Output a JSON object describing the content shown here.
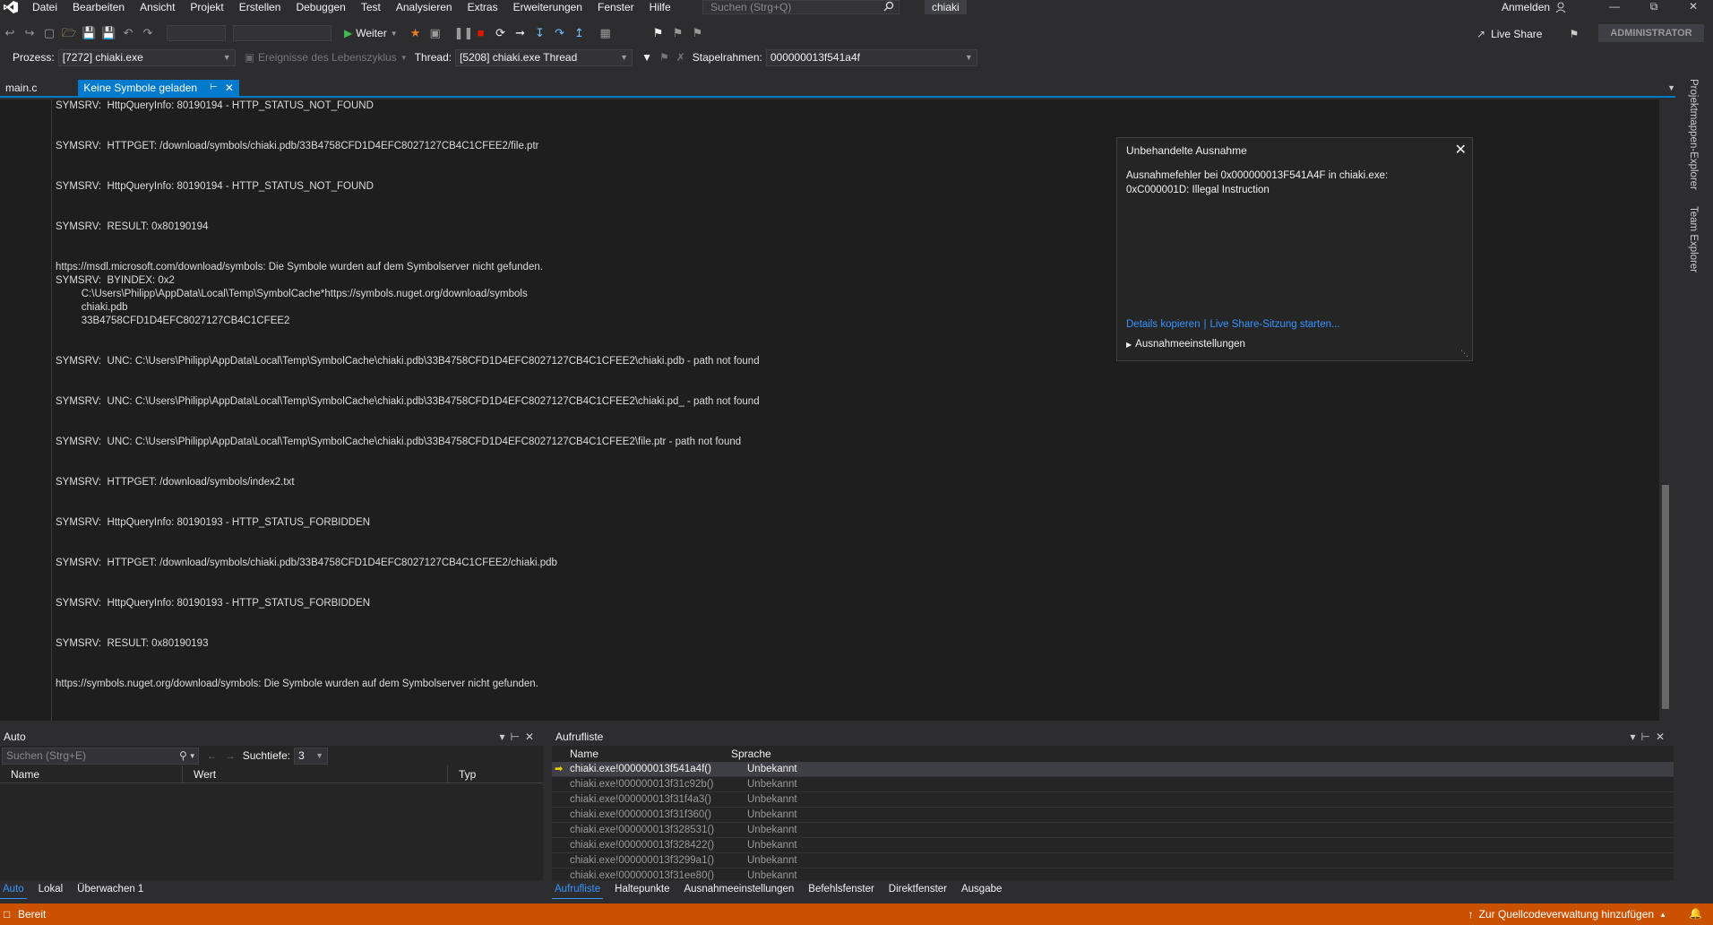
{
  "menubar": {
    "items": [
      "Datei",
      "Bearbeiten",
      "Ansicht",
      "Projekt",
      "Erstellen",
      "Debuggen",
      "Test",
      "Analysieren",
      "Extras",
      "Erweiterungen",
      "Fenster",
      "Hilfe"
    ],
    "search_placeholder": "Suchen (Strg+Q)",
    "solution": "chiaki",
    "signin": "Anmelden"
  },
  "toolbar": {
    "continue_label": "Weiter",
    "liveshare_label": "Live Share",
    "admin_label": "ADMINISTRATOR"
  },
  "debug_location": {
    "process_label": "Prozess:",
    "process_value": "[7272] chiaki.exe",
    "lifecycle_label": "Ereignisse des Lebenszyklus",
    "thread_label": "Thread:",
    "thread_value": "[5208] chiaki.exe Thread",
    "frame_label": "Stapelrahmen:",
    "frame_value": "000000013f541a4f"
  },
  "doc_tabs": {
    "file_tab": "main.c",
    "active_tab": "Keine Symbole geladen"
  },
  "log_lines": [
    "SYMSRV:  HttpQueryInfo: 80190194 - HTTP_STATUS_NOT_FOUND",
    "",
    "",
    "SYMSRV:  HTTPGET: /download/symbols/chiaki.pdb/33B4758CFD1D4EFC8027127CB4C1CFEE2/file.ptr",
    "",
    "",
    "SYMSRV:  HttpQueryInfo: 80190194 - HTTP_STATUS_NOT_FOUND",
    "",
    "",
    "SYMSRV:  RESULT: 0x80190194",
    "",
    "",
    "https://msdl.microsoft.com/download/symbols: Die Symbole wurden auf dem Symbolserver nicht gefunden.",
    "SYMSRV:  BYINDEX: 0x2",
    "         C:\\Users\\Philipp\\AppData\\Local\\Temp\\SymbolCache*https://symbols.nuget.org/download/symbols",
    "         chiaki.pdb",
    "         33B4758CFD1D4EFC8027127CB4C1CFEE2",
    "",
    "",
    "SYMSRV:  UNC: C:\\Users\\Philipp\\AppData\\Local\\Temp\\SymbolCache\\chiaki.pdb\\33B4758CFD1D4EFC8027127CB4C1CFEE2\\chiaki.pdb - path not found",
    "",
    "",
    "SYMSRV:  UNC: C:\\Users\\Philipp\\AppData\\Local\\Temp\\SymbolCache\\chiaki.pdb\\33B4758CFD1D4EFC8027127CB4C1CFEE2\\chiaki.pd_ - path not found",
    "",
    "",
    "SYMSRV:  UNC: C:\\Users\\Philipp\\AppData\\Local\\Temp\\SymbolCache\\chiaki.pdb\\33B4758CFD1D4EFC8027127CB4C1CFEE2\\file.ptr - path not found",
    "",
    "",
    "SYMSRV:  HTTPGET: /download/symbols/index2.txt",
    "",
    "",
    "SYMSRV:  HttpQueryInfo: 80190193 - HTTP_STATUS_FORBIDDEN",
    "",
    "",
    "SYMSRV:  HTTPGET: /download/symbols/chiaki.pdb/33B4758CFD1D4EFC8027127CB4C1CFEE2/chiaki.pdb",
    "",
    "",
    "SYMSRV:  HttpQueryInfo: 80190193 - HTTP_STATUS_FORBIDDEN",
    "",
    "",
    "SYMSRV:  RESULT: 0x80190193",
    "",
    "",
    "https://symbols.nuget.org/download/symbols: Die Symbole wurden auf dem Symbolserver nicht gefunden."
  ],
  "exception": {
    "title": "Unbehandelte Ausnahme",
    "message_line1": "Ausnahmefehler bei 0x000000013F541A4F in chiaki.exe:",
    "message_line2": "0xC000001D: Illegal Instruction",
    "link_copy": "Details kopieren",
    "link_liveshare": "Live Share-Sitzung starten...",
    "settings": "Ausnahmeeinstellungen"
  },
  "side_tabs": [
    "Projektmappen-Explorer",
    "Team Explorer"
  ],
  "auto_panel": {
    "title": "Auto",
    "search_placeholder": "Suchen (Strg+E)",
    "depth_label": "Suchtiefe:",
    "depth_value": "3",
    "columns": [
      "Name",
      "Wert",
      "Typ"
    ],
    "tabs": [
      "Auto",
      "Lokal",
      "Überwachen 1"
    ]
  },
  "call_panel": {
    "title": "Aufrufliste",
    "columns": [
      "Name",
      "Sprache"
    ],
    "rows": [
      {
        "name": "chiaki.exe!000000013f541a4f()",
        "lang": "Unbekannt"
      },
      {
        "name": "chiaki.exe!000000013f31c92b()",
        "lang": "Unbekannt"
      },
      {
        "name": "chiaki.exe!000000013f31f4a3()",
        "lang": "Unbekannt"
      },
      {
        "name": "chiaki.exe!000000013f31f360()",
        "lang": "Unbekannt"
      },
      {
        "name": "chiaki.exe!000000013f328531()",
        "lang": "Unbekannt"
      },
      {
        "name": "chiaki.exe!000000013f328422()",
        "lang": "Unbekannt"
      },
      {
        "name": "chiaki.exe!000000013f3299a1()",
        "lang": "Unbekannt"
      },
      {
        "name": "chiaki.exe!000000013f31ee80()",
        "lang": "Unbekannt"
      }
    ],
    "tabs": [
      "Aufrufliste",
      "Haltepunkte",
      "Ausnahmeeinstellungen",
      "Befehlsfenster",
      "Direktfenster",
      "Ausgabe"
    ]
  },
  "statusbar": {
    "ready": "Bereit",
    "scc": "Zur Quellcodeverwaltung hinzufügen"
  },
  "colors": {
    "accent": "#007acc",
    "status": "#ca5100",
    "link": "#3794ff"
  }
}
